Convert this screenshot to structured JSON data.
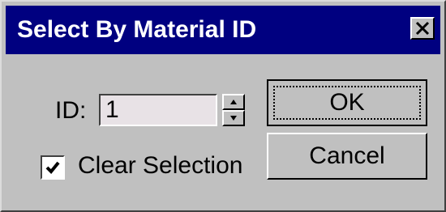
{
  "window": {
    "title": "Select By Material ID",
    "titlebar_color": "#000080",
    "close_icon": "close-icon"
  },
  "form": {
    "id_label": "ID:",
    "id_value": "1",
    "spinner_icons": [
      "spinner-up-icon",
      "spinner-down-icon"
    ],
    "clear_selection_label": "Clear Selection",
    "clear_selection_checked": true
  },
  "buttons": {
    "ok_label": "OK",
    "cancel_label": "Cancel"
  }
}
